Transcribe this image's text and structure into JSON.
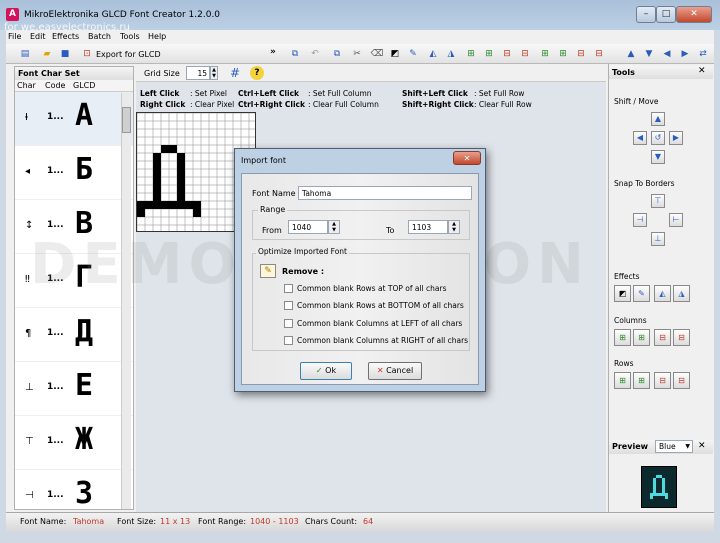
{
  "window": {
    "title": "MikroElektronika GLCD Font Creator 1.2.0.0",
    "watermark": "for we.easyelectronics.ru",
    "app_icon_glyph": "A"
  },
  "menu": [
    "File",
    "Edit",
    "Effects",
    "Batch",
    "Tools",
    "Help"
  ],
  "toolbar": {
    "export_label": "Export for GLCD",
    "overflow_glyph": "»"
  },
  "char_set": {
    "title": "Font Char Set",
    "columns": [
      "Char",
      "Code",
      "GLCD"
    ],
    "rows": [
      {
        "char": "Ɨ",
        "code": "1...",
        "glcd": "А"
      },
      {
        "char": "◂",
        "code": "1...",
        "glcd": "Б"
      },
      {
        "char": "↕",
        "code": "1...",
        "glcd": "В"
      },
      {
        "char": "‼",
        "code": "1...",
        "glcd": "Г"
      },
      {
        "char": "¶",
        "code": "1...",
        "glcd": "Д"
      },
      {
        "char": "⊥",
        "code": "1...",
        "glcd": "Е"
      },
      {
        "char": "⊤",
        "code": "1...",
        "glcd": "Ж"
      },
      {
        "char": "⊣",
        "code": "1...",
        "glcd": "З"
      }
    ]
  },
  "grid": {
    "size_label": "Grid Size",
    "size_value": "15"
  },
  "mouse_help": [
    {
      "key": "Left Click",
      "action": ": Set Pixel",
      "key2": "Ctrl+Left Click",
      "action2": ": Set Full Column",
      "key3": "Shift+Left Click",
      "action3": ": Set Full Row"
    },
    {
      "key": "Right Click",
      "action": ": Clear Pixel",
      "key2": "Ctrl+Right Click",
      "action2": ": Clear Full Column",
      "key3": "Shift+Right Click",
      "action3": ": Clear Full Row"
    }
  ],
  "demo_watermark": "DEMO VERSION",
  "tools": {
    "title": "Tools",
    "shift_move": "Shift / Move",
    "snap": "Snap To Borders",
    "effects": "Effects",
    "columns": "Columns",
    "rows": "Rows",
    "preview": "Preview",
    "preview_color": "Blue"
  },
  "dialog": {
    "title": "Import font",
    "font_name_label": "Font Name",
    "font_name_value": "Tahoma",
    "range_label": "Range",
    "from_label": "From",
    "from_value": "1040",
    "to_label": "To",
    "to_value": "1103",
    "optimize_label": "Optimize Imported Font",
    "remove_label": "Remove :",
    "options": [
      "Common blank Rows at TOP of all chars",
      "Common blank Rows at BOTTOM of all chars",
      "Common blank Columns at LEFT of all chars",
      "Common blank Columns at RIGHT of all chars"
    ],
    "ok_label": "Ok",
    "cancel_label": "Cancel"
  },
  "status": {
    "font_name_label": "Font Name:",
    "font_name_value": "Tahoma",
    "font_size_label": "Font Size:",
    "font_size_value": "11 x 13",
    "font_range_label": "Font Range:",
    "font_range_value": "1040 - 1103",
    "chars_count_label": "Chars Count:",
    "chars_count_value": "64"
  },
  "colors": {
    "accent_red": "#c0392b",
    "titlebar": "#b6cbe1"
  }
}
